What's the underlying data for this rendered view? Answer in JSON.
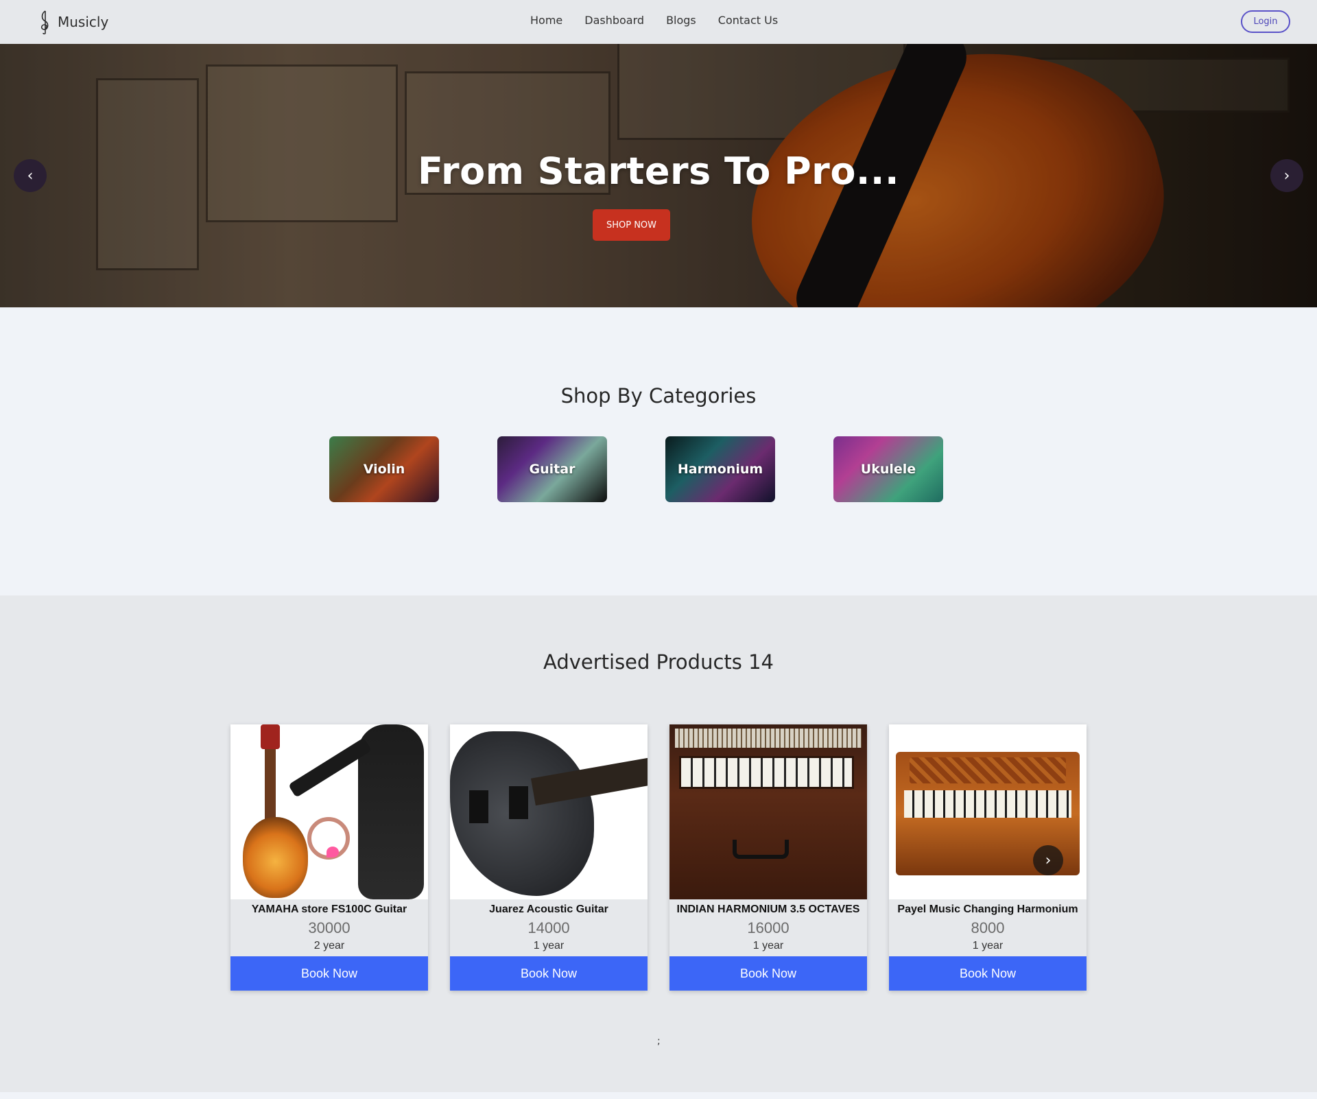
{
  "nav": {
    "brand": "Musicly",
    "links": [
      "Home",
      "Dashboard",
      "Blogs",
      "Contact Us"
    ],
    "login_label": "Login"
  },
  "hero": {
    "title": "From Starters To Pro...",
    "cta_label": "SHOP NOW",
    "prev_icon": "‹",
    "next_icon": "›"
  },
  "categories": {
    "title": "Shop By Categories",
    "items": [
      "Violin",
      "Guitar",
      "Harmonium",
      "Ukulele"
    ]
  },
  "products": {
    "title": "Advertised Products 14",
    "items": [
      {
        "name": "YAMAHA store FS100C Guitar",
        "price": "30000",
        "duration": "2 year",
        "button": "Book Now"
      },
      {
        "name": "Juarez Acoustic Guitar",
        "price": "14000",
        "duration": "1 year",
        "button": "Book Now"
      },
      {
        "name": "INDIAN HARMONIUM 3.5 OCTAVES",
        "price": "16000",
        "duration": "1 year",
        "button": "Book Now"
      },
      {
        "name": "Payel Music Changing Harmonium",
        "price": "8000",
        "duration": "1 year",
        "button": "Book Now"
      }
    ]
  },
  "footer": {
    "mark": ";"
  },
  "colors": {
    "accent": "#3c66f7",
    "cta": "#c7311f",
    "login": "#5a52c8"
  }
}
